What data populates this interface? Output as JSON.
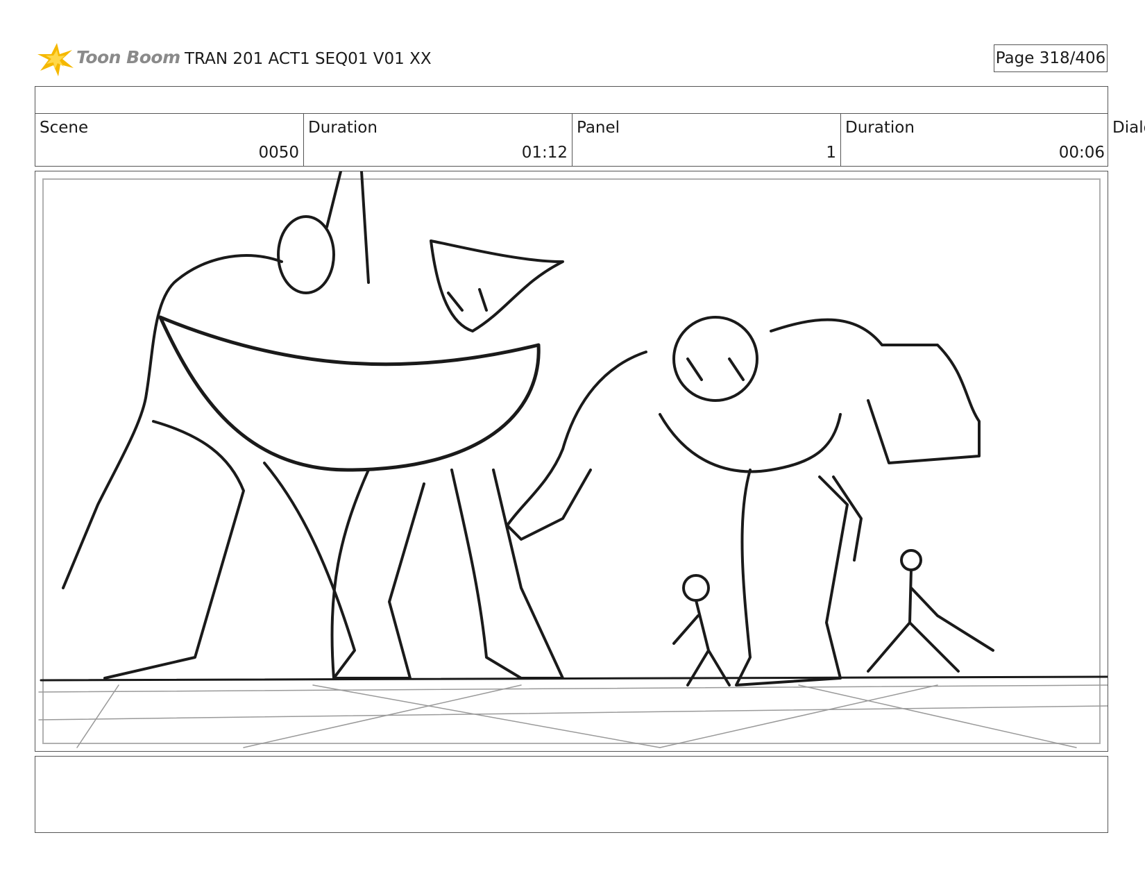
{
  "header": {
    "brand": "Toon Boom",
    "title": "TRAN 201 ACT1 SEQ01 V01 XX",
    "page": "Page 318/406"
  },
  "info": {
    "scene_label": "Scene",
    "scene_value": "0050",
    "scene_duration_label": "Duration",
    "scene_duration_value": "01:12",
    "panel_label": "Panel",
    "panel_value": "1",
    "panel_duration_label": "Duration",
    "panel_duration_value": "00:06",
    "dialog_label": "Dialo"
  },
  "colors": {
    "logo_star": "#f5b800",
    "logo_text": "#8a8a8a",
    "line": "#1a1a1a",
    "border": "#555555"
  }
}
